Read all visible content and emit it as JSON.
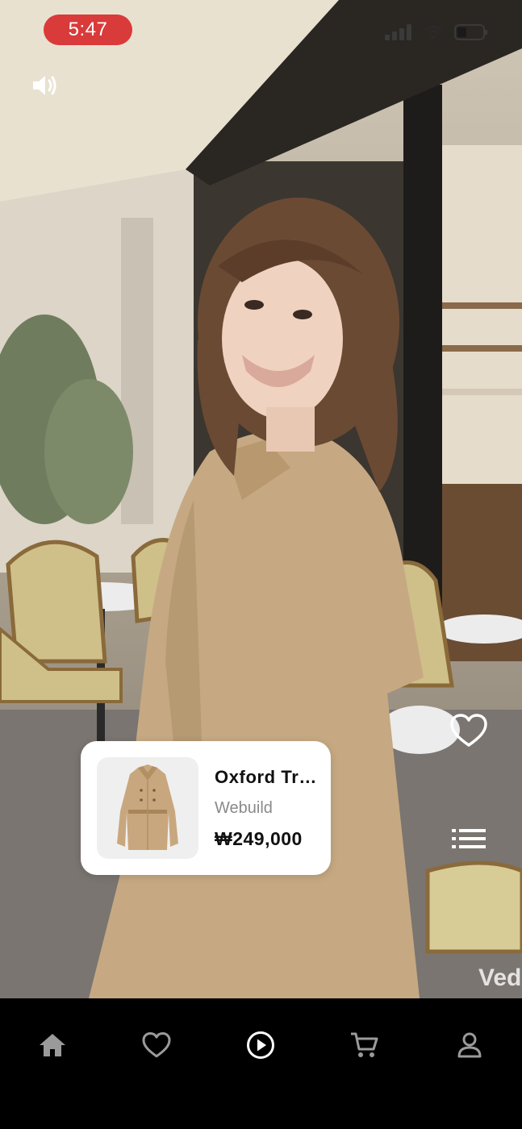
{
  "status_bar": {
    "time": "5:47"
  },
  "video": {
    "watermark": "Ved"
  },
  "product": {
    "name": "Oxford Trench Coat",
    "brand": "Webuild",
    "price": "₩249,000"
  },
  "icons": {
    "volume": "speaker-icon",
    "like": "heart-outline-icon",
    "list": "list-icon",
    "home": "home-icon",
    "wishlist": "heart-outline-icon",
    "play": "play-circle-icon",
    "cart": "cart-icon",
    "profile": "person-icon"
  },
  "colors": {
    "time_pill": "#d93a3a",
    "active_nav": "#ffffff",
    "inactive_nav": "#9a9a9a"
  }
}
